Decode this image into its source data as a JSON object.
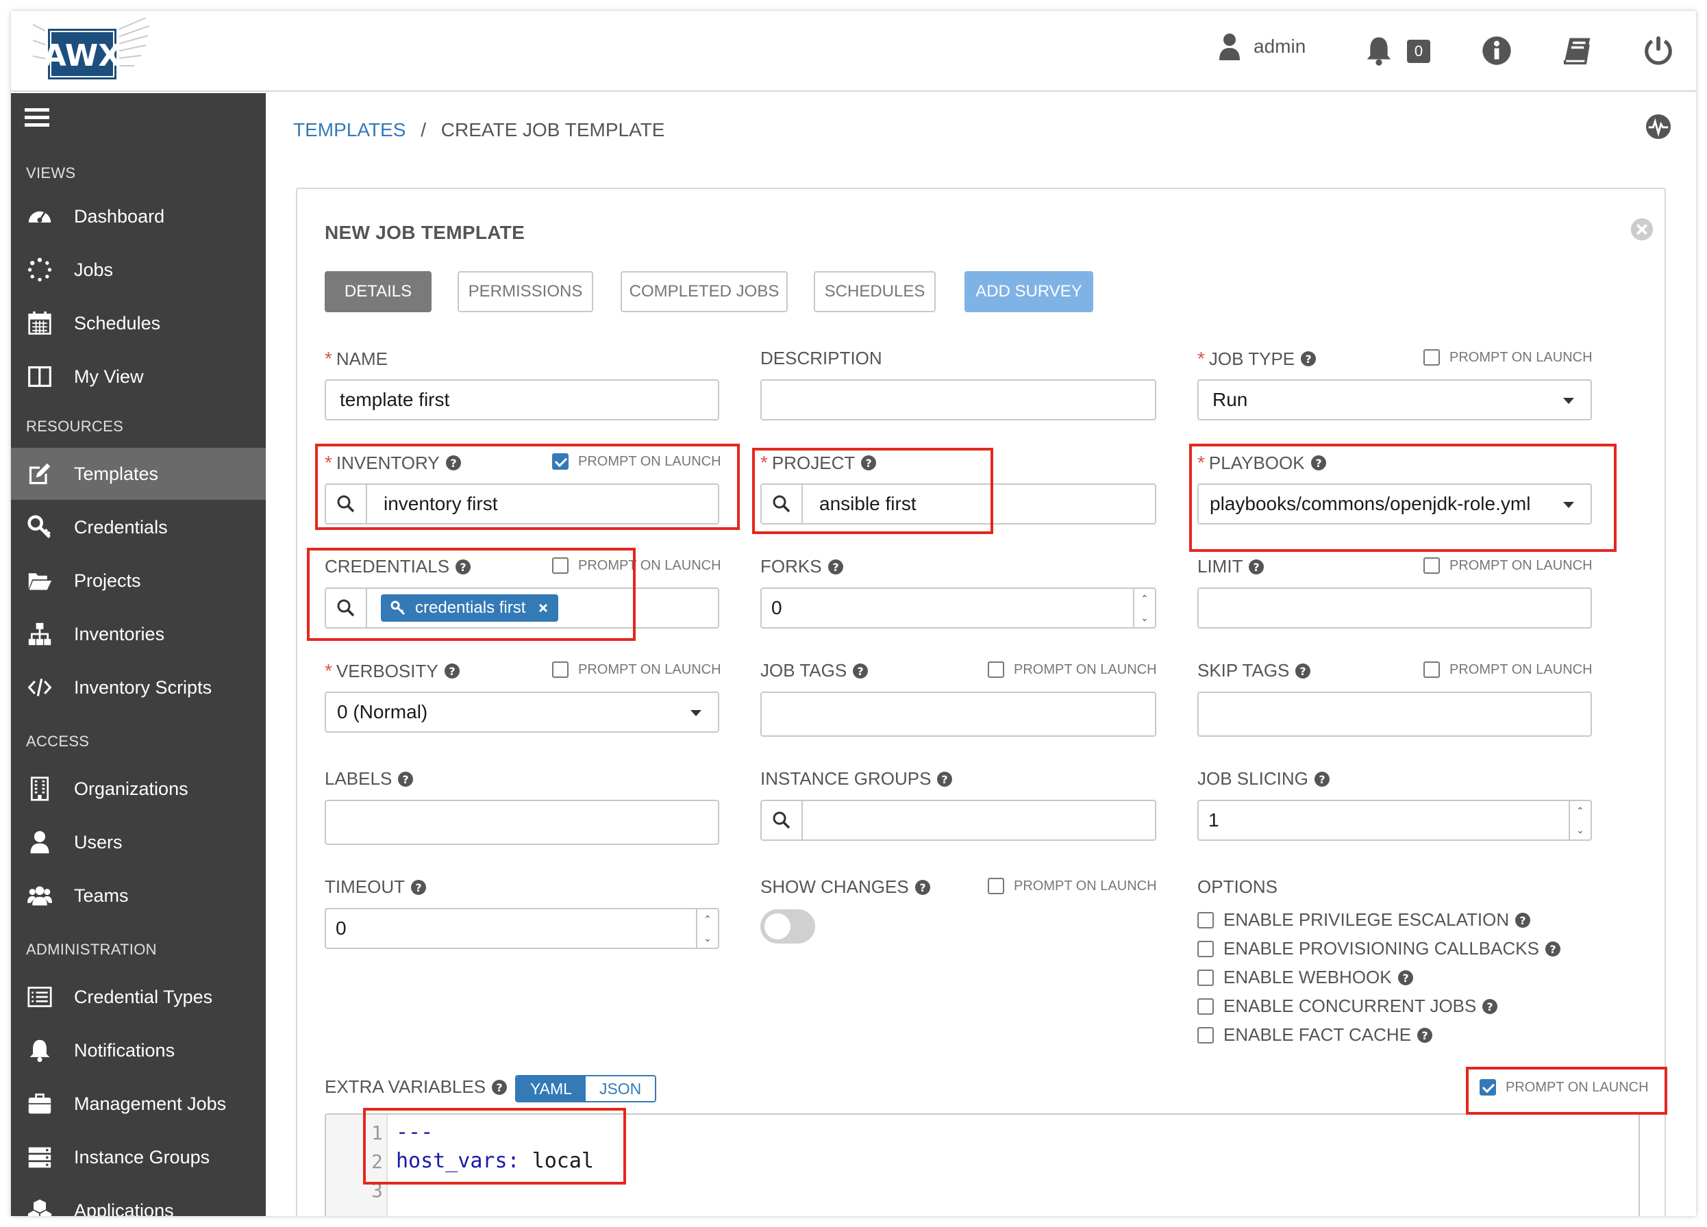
{
  "header": {
    "logo_text": "AWX",
    "user": "admin",
    "notifications_count": "0"
  },
  "sidebar": {
    "sections": {
      "views": "VIEWS",
      "resources": "RESOURCES",
      "access": "ACCESS",
      "administration": "ADMINISTRATION"
    },
    "items": {
      "dashboard": "Dashboard",
      "jobs": "Jobs",
      "schedules": "Schedules",
      "my_view": "My View",
      "templates": "Templates",
      "credentials": "Credentials",
      "projects": "Projects",
      "inventories": "Inventories",
      "inventory_scripts": "Inventory Scripts",
      "organizations": "Organizations",
      "users": "Users",
      "teams": "Teams",
      "credential_types": "Credential Types",
      "notifications": "Notifications",
      "management_jobs": "Management Jobs",
      "instance_groups": "Instance Groups",
      "applications": "Applications"
    }
  },
  "breadcrumb": {
    "templates": "TEMPLATES",
    "separator": "/",
    "current": "CREATE JOB TEMPLATE"
  },
  "panel": {
    "title": "NEW JOB TEMPLATE",
    "tabs": {
      "details": "DETAILS",
      "permissions": "PERMISSIONS",
      "completed_jobs": "COMPLETED JOBS",
      "schedules": "SCHEDULES",
      "add_survey": "ADD SURVEY"
    }
  },
  "form": {
    "prompt_on_launch": "PROMPT ON LAUNCH",
    "name": {
      "label": "NAME",
      "value": "template first"
    },
    "description": {
      "label": "DESCRIPTION",
      "value": ""
    },
    "job_type": {
      "label": "JOB TYPE",
      "value": "Run"
    },
    "inventory": {
      "label": "INVENTORY",
      "value": "inventory first",
      "prompt": true
    },
    "project": {
      "label": "PROJECT",
      "value": "ansible first"
    },
    "playbook": {
      "label": "PLAYBOOK",
      "value": "playbooks/commons/openjdk-role.yml"
    },
    "credentials": {
      "label": "CREDENTIALS",
      "chip": "credentials first",
      "prompt": false
    },
    "forks": {
      "label": "FORKS",
      "value": "0"
    },
    "limit": {
      "label": "LIMIT",
      "value": ""
    },
    "verbosity": {
      "label": "VERBOSITY",
      "value": "0 (Normal)"
    },
    "job_tags": {
      "label": "JOB TAGS",
      "value": ""
    },
    "skip_tags": {
      "label": "SKIP TAGS",
      "value": ""
    },
    "labels": {
      "label": "LABELS"
    },
    "instance_groups": {
      "label": "INSTANCE GROUPS"
    },
    "job_slicing": {
      "label": "JOB SLICING",
      "value": "1"
    },
    "timeout": {
      "label": "TIMEOUT",
      "value": "0"
    },
    "show_changes": {
      "label": "SHOW CHANGES",
      "on": false
    },
    "options": {
      "label": "OPTIONS",
      "items": {
        "privilege_escalation": "ENABLE PRIVILEGE ESCALATION",
        "provisioning_callbacks": "ENABLE PROVISIONING CALLBACKS",
        "webhook": "ENABLE WEBHOOK",
        "concurrent_jobs": "ENABLE CONCURRENT JOBS",
        "fact_cache": "ENABLE FACT CACHE"
      }
    },
    "extra_variables": {
      "label": "EXTRA VARIABLES",
      "yaml": "YAML",
      "json": "JSON",
      "prompt": true,
      "lines": [
        "---",
        "host_vars:",
        "local"
      ],
      "line_numbers": [
        "1",
        "2",
        "3"
      ]
    }
  },
  "colors": {
    "sidebar_bg": "#3f3f3f",
    "accent": "#337ab7",
    "highlight_box": "#e3281d",
    "required": "#d9534f"
  }
}
